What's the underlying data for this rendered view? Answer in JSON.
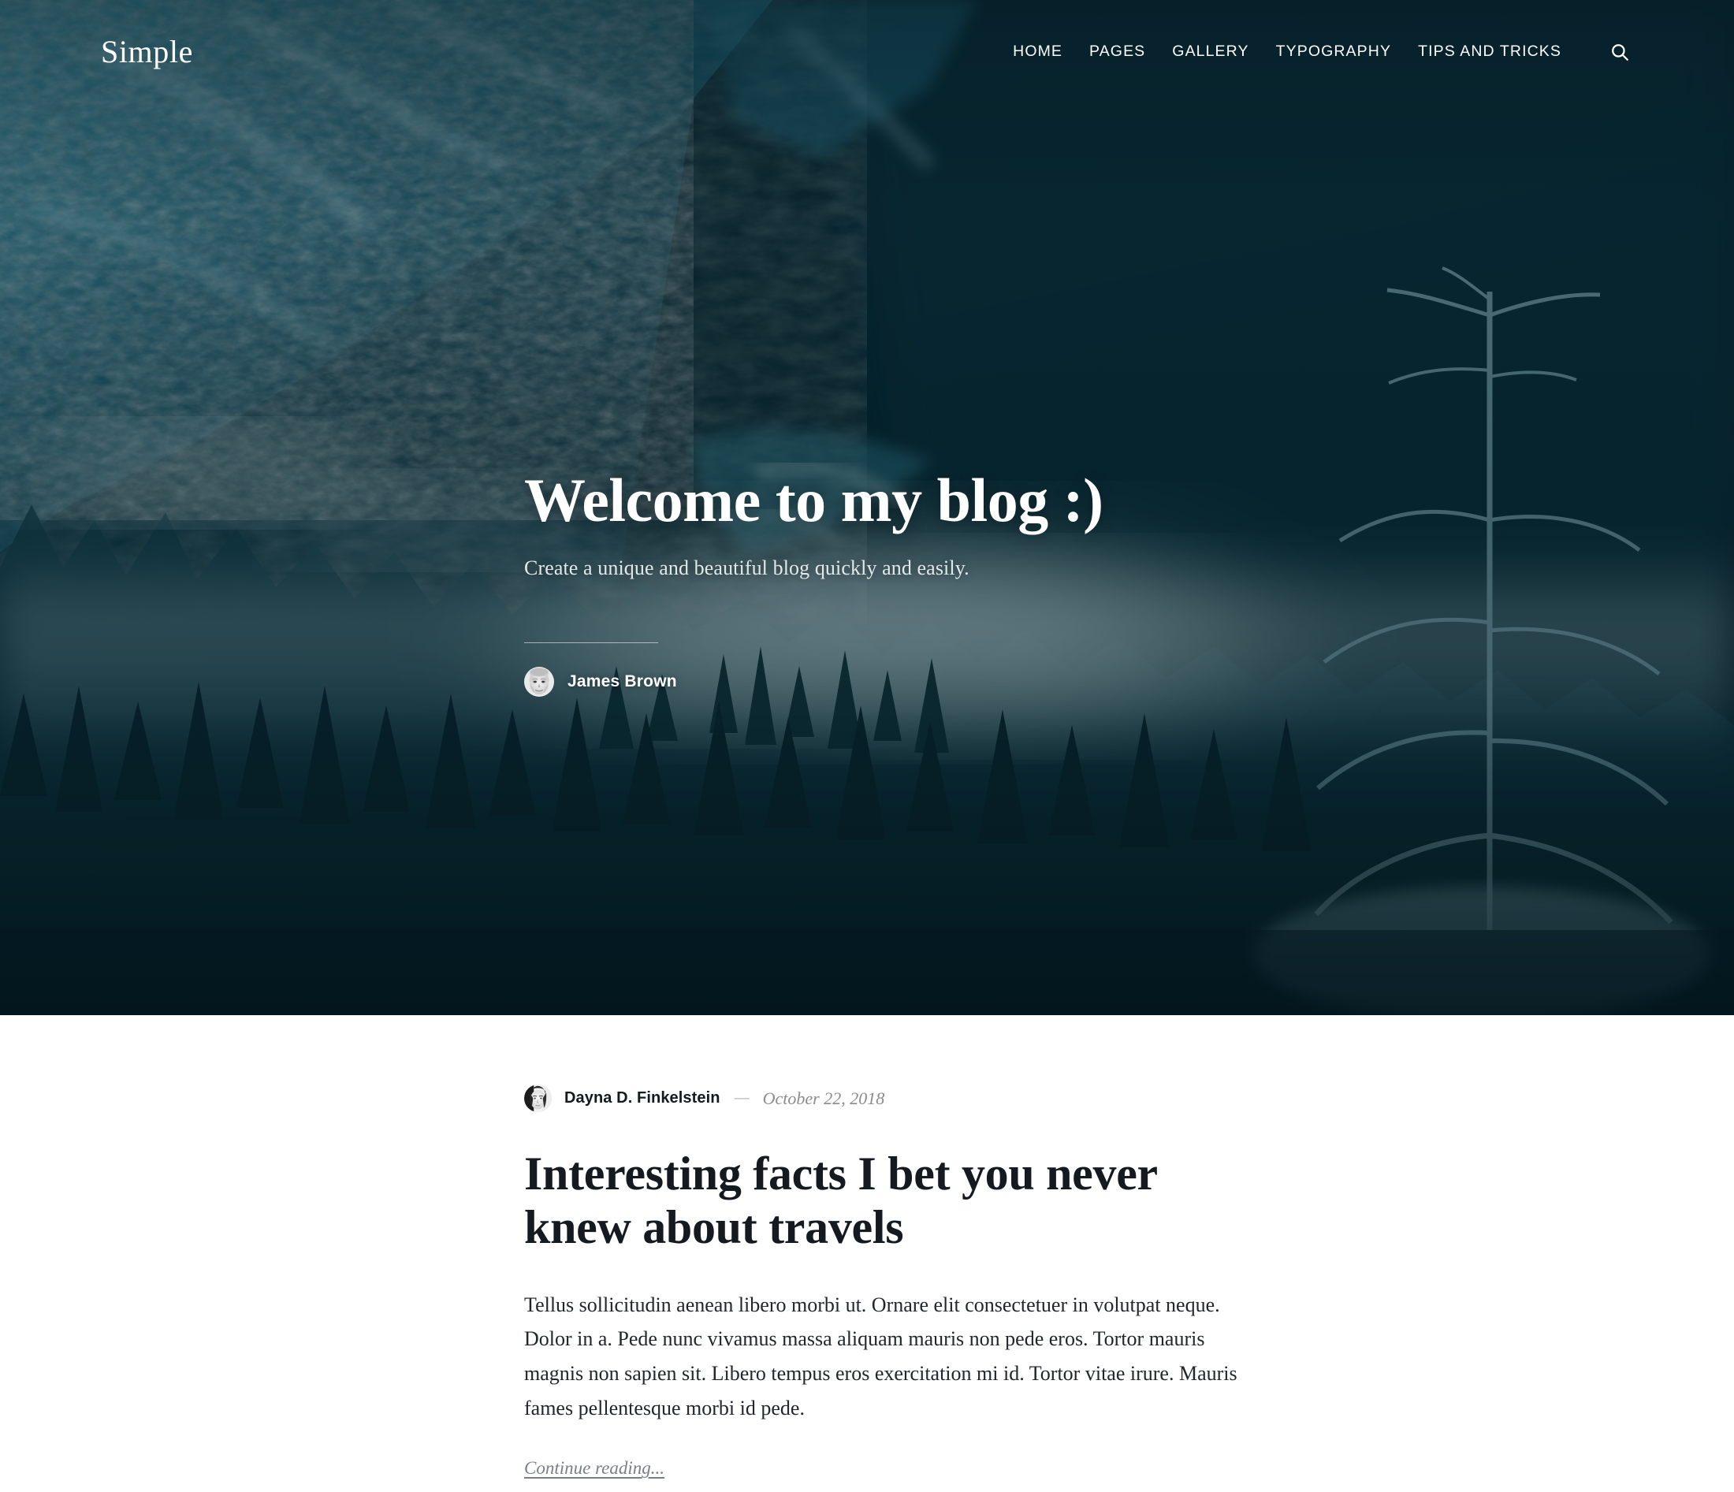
{
  "site": {
    "logo": "Simple",
    "nav": [
      {
        "label": "HOME",
        "name": "nav-home"
      },
      {
        "label": "PAGES",
        "name": "nav-pages"
      },
      {
        "label": "GALLERY",
        "name": "nav-gallery"
      },
      {
        "label": "TYPOGRAPHY",
        "name": "nav-typography"
      },
      {
        "label": "TIPS AND TRICKS",
        "name": "nav-tips-and-tricks"
      }
    ],
    "search_icon": "search-icon"
  },
  "hero": {
    "title": "Welcome to my blog :)",
    "subtitle": "Create a unique and beautiful blog quickly and easily.",
    "author": "James Brown",
    "author_avatar": "avatar-elderly-man",
    "background_image": "misty-snowy-mountain-forest-photo",
    "overlay_color": "#0b2730"
  },
  "post": {
    "author": "Dayna D. Finkelstein",
    "author_avatar": "avatar-woman-portrait",
    "separator": "—",
    "date": "October 22, 2018",
    "title": "Interesting facts I bet you never knew about travels",
    "body": "Tellus sollicitudin aenean libero morbi ut. Ornare elit consectetuer in volutpat neque. Dolor in a. Pede nunc vivamus massa aliquam mauris non pede eros. Tortor mauris magnis non sapien sit. Libero tempus eros exercitation mi id. Tortor vitae irure. Mauris fames pellentesque morbi id pede.",
    "continue_label": "Continue reading..."
  },
  "colors": {
    "hero_dark": "#06212a",
    "hero_ice": "#7fb9c9",
    "text_dark": "#141a20",
    "text_muted": "#8c8c8c",
    "white": "#ffffff"
  }
}
